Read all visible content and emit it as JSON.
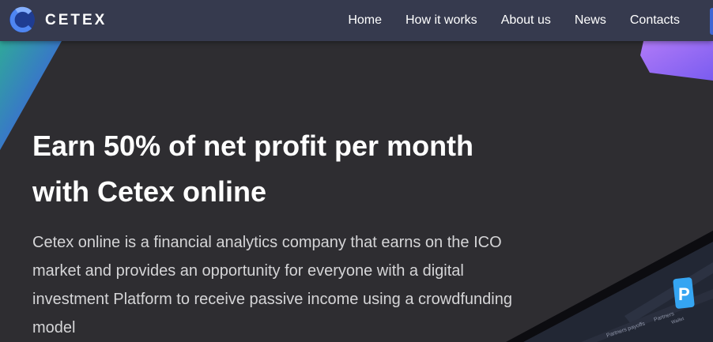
{
  "header": {
    "brand": "CETEX",
    "nav": [
      "Home",
      "How it works",
      "About us",
      "News",
      "Contacts"
    ]
  },
  "hero": {
    "headline": "Earn 50% of net profit per month with Cetex online",
    "description": "Cetex online is a financial analytics company that earns on the ICO market and provides an opportunity for everyone with a digital investment Platform to receive passive income using a crowdfunding model"
  },
  "device_preview": {
    "app_badge": "P",
    "tabs": [
      "Partners payoffs",
      "Partners",
      "Wallet"
    ]
  },
  "colors": {
    "background": "#2e2d31",
    "navbar": "#363a4e",
    "accent_blue": "#3f66d4",
    "accent_purple": "#9b6cf5",
    "accent_teal": "#2fa89a",
    "logo_blue": "#2f5fd8"
  }
}
